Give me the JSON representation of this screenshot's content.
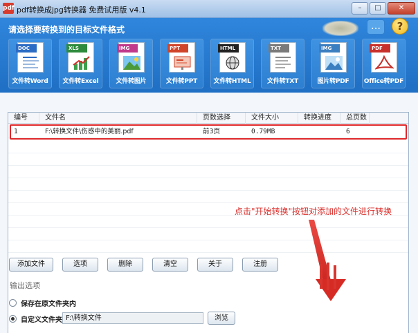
{
  "window": {
    "title": "pdf转换成jpg转换器 免费试用版 v4.1",
    "app_icon_text": "pdf",
    "controls": {
      "minimize": "–",
      "maximize": "□",
      "close": "✕"
    }
  },
  "header": {
    "title": "请选择要转换到的目标文件格式",
    "icons": {
      "chat": "chat-icon",
      "help": "?"
    }
  },
  "tools": [
    {
      "badge": "DOC",
      "label": "文件转Word",
      "color": "#2b6cc4",
      "icon": "word-doc-icon"
    },
    {
      "badge": "XLS",
      "label": "文件转Excel",
      "color": "#2e8b3d",
      "icon": "excel-chart-icon"
    },
    {
      "badge": "IMG",
      "label": "文件转图片",
      "color": "#c0398b",
      "icon": "image-icon"
    },
    {
      "badge": "PPT",
      "label": "文件转PPT",
      "color": "#d0452a",
      "icon": "ppt-icon"
    },
    {
      "badge": "HTML",
      "label": "文件转HTML",
      "color": "#222222",
      "icon": "html-globe-icon"
    },
    {
      "badge": "TXT",
      "label": "文件转TXT",
      "color": "#7a7a7a",
      "icon": "txt-icon"
    },
    {
      "badge": "IMG",
      "label": "图片转PDF",
      "color": "#3c7fc0",
      "icon": "image-to-pdf-icon"
    },
    {
      "badge": "PDF",
      "label": "Office转PDF",
      "color": "#c8312b",
      "icon": "pdf-acrobat-icon"
    }
  ],
  "table": {
    "columns": [
      "编号",
      "文件名",
      "页数选择",
      "文件大小",
      "转换进度",
      "总页数"
    ],
    "rows": [
      {
        "id": "1",
        "file": "F:\\转换文件\\伤感中的美丽.pdf",
        "pages": "前3页",
        "size": "0.79MB",
        "progress": "",
        "total": "6"
      }
    ]
  },
  "hint": "点击\"开始转换\"按钮对添加的文件进行转换",
  "buttons": {
    "add": "添加文件",
    "options": "选项",
    "delete": "删除",
    "clear": "清空",
    "about": "关于",
    "register": "注册"
  },
  "output": {
    "section_label": "输出选项",
    "save_in_source": "保存在原文件夹内",
    "custom_folder": "自定义文件夹",
    "path": "F:\\转换文件",
    "browse": "浏览",
    "selected": "custom"
  },
  "colors": {
    "header_blue": "#2f86dc",
    "highlight_red": "#e0282b",
    "hint_red": "#d9302c"
  }
}
